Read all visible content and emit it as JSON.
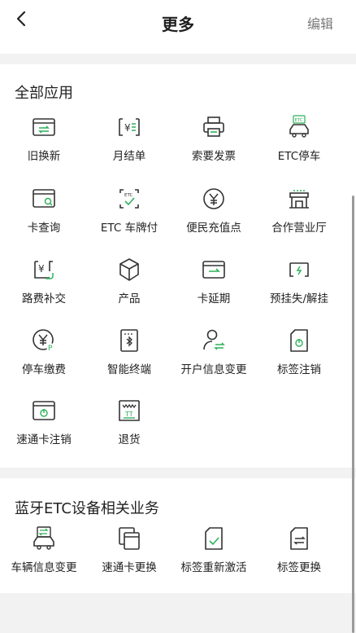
{
  "header": {
    "title": "更多",
    "edit_label": "编辑",
    "back_icon": "chevron-left-icon"
  },
  "sections": [
    {
      "title": "全部应用",
      "items": [
        {
          "label": "旧换新",
          "icon": "card-exchange-icon"
        },
        {
          "label": "月结单",
          "icon": "monthly-bill-icon"
        },
        {
          "label": "索要发票",
          "icon": "printer-icon"
        },
        {
          "label": "ETC停车",
          "icon": "etc-parking-icon"
        },
        {
          "label": "卡查询",
          "icon": "card-search-icon"
        },
        {
          "label": "ETC 车牌付",
          "icon": "etc-plate-pay-icon"
        },
        {
          "label": "便民充值点",
          "icon": "yuan-location-icon"
        },
        {
          "label": "合作营业厅",
          "icon": "store-icon"
        },
        {
          "label": "路费补交",
          "icon": "toll-payment-icon"
        },
        {
          "label": "产品",
          "icon": "cube-icon"
        },
        {
          "label": "卡延期",
          "icon": "card-extend-icon"
        },
        {
          "label": "预挂失/解挂",
          "icon": "report-loss-icon"
        },
        {
          "label": "停车缴费",
          "icon": "parking-fee-icon"
        },
        {
          "label": "智能终端",
          "icon": "bluetooth-terminal-icon"
        },
        {
          "label": "开户信息变更",
          "icon": "user-change-icon"
        },
        {
          "label": "标签注销",
          "icon": "tag-cancel-icon"
        },
        {
          "label": "速通卡注销",
          "icon": "card-cancel-icon"
        },
        {
          "label": "退货",
          "icon": "return-goods-icon"
        }
      ]
    },
    {
      "title": "蓝牙ETC设备相关业务",
      "items": [
        {
          "label": "车辆信息变更",
          "icon": "vehicle-change-icon"
        },
        {
          "label": "速通卡更换",
          "icon": "card-replace-icon"
        },
        {
          "label": "标签重新激活",
          "icon": "tag-reactivate-icon"
        },
        {
          "label": "标签更换",
          "icon": "tag-replace-icon"
        }
      ]
    }
  ],
  "colors": {
    "accent": "#2db15a",
    "text": "#222222",
    "muted": "#7a7a7a",
    "divider": "#f2f2f2"
  }
}
